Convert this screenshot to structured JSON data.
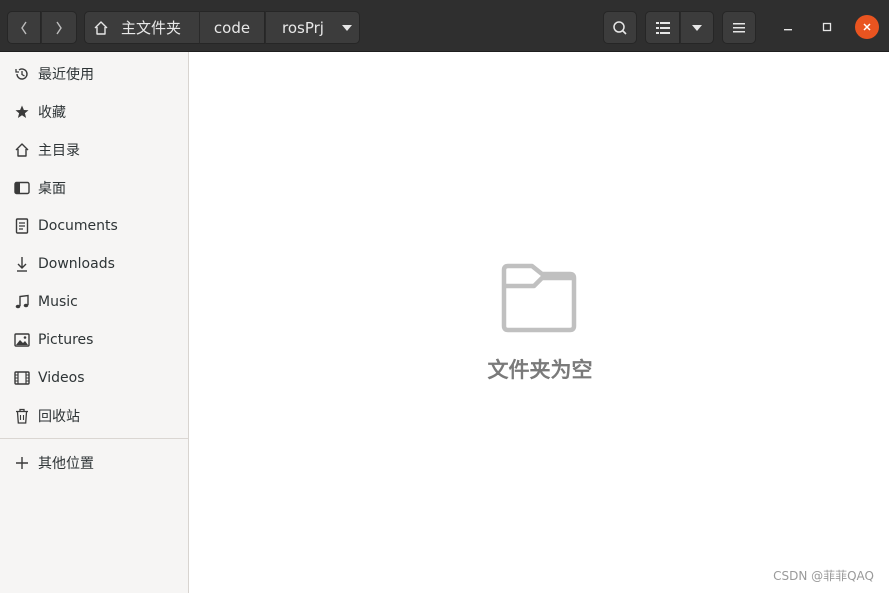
{
  "header": {
    "breadcrumbs": [
      "主文件夹",
      "code",
      "rosPrj"
    ],
    "icons": {
      "back": "chevron-left-icon",
      "forward": "chevron-right-icon",
      "home": "home-icon",
      "crumb_menu": "caret-down-icon",
      "search": "search-icon",
      "view_list": "list-view-icon",
      "view_options": "caret-down-icon",
      "menu": "hamburger-menu-icon",
      "minimize": "minimize-icon",
      "maximize": "maximize-icon",
      "close": "close-icon"
    }
  },
  "sidebar": {
    "items": [
      {
        "label": "最近使用",
        "icon": "recent-icon"
      },
      {
        "label": "收藏",
        "icon": "star-icon"
      },
      {
        "label": "主目录",
        "icon": "home-icon"
      },
      {
        "label": "桌面",
        "icon": "desktop-icon"
      },
      {
        "label": "Documents",
        "icon": "document-icon"
      },
      {
        "label": "Downloads",
        "icon": "download-icon"
      },
      {
        "label": "Music",
        "icon": "music-icon"
      },
      {
        "label": "Pictures",
        "icon": "picture-icon"
      },
      {
        "label": "Videos",
        "icon": "video-icon"
      },
      {
        "label": "回收站",
        "icon": "trash-icon"
      }
    ],
    "other_locations": {
      "label": "其他位置",
      "icon": "plus-icon"
    }
  },
  "main": {
    "empty_state": {
      "label": "文件夹为空",
      "icon": "folder-icon"
    },
    "watermark": "CSDN @菲菲QAQ"
  },
  "colors": {
    "headerbar": "#2f2f2f",
    "close_button": "#e95420",
    "sidebar_bg": "#f6f5f4",
    "empty_text": "#7a7a7a"
  }
}
